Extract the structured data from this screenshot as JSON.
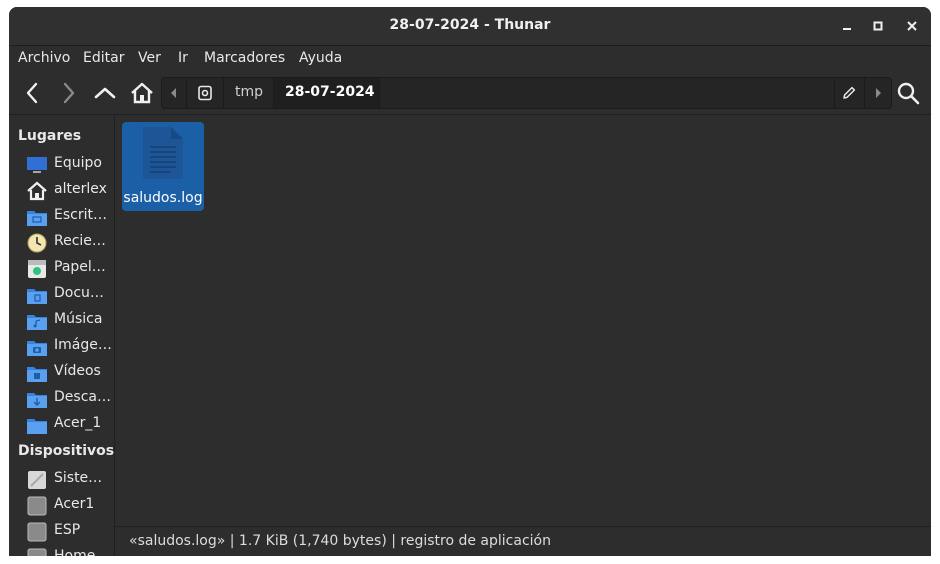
{
  "window": {
    "title": "28-07-2024 - Thunar"
  },
  "menubar": {
    "items": [
      "Archivo",
      "Editar",
      "Ver",
      "Ir",
      "Marcadores",
      "Ayuda"
    ]
  },
  "pathbar": {
    "segments": [
      "tmp",
      "28-07-2024"
    ]
  },
  "sidebar": {
    "places_header": "Lugares",
    "places": [
      {
        "label": "Equipo",
        "icon": "computer-icon"
      },
      {
        "label": "alterlex",
        "icon": "home-icon"
      },
      {
        "label": "Escrit…",
        "icon": "desktop-folder-icon"
      },
      {
        "label": "Recie…",
        "icon": "recent-clock-icon"
      },
      {
        "label": "Papel…",
        "icon": "trash-icon"
      },
      {
        "label": "Docu…",
        "icon": "documents-folder-icon"
      },
      {
        "label": "Música",
        "icon": "music-folder-icon"
      },
      {
        "label": "Imáge…",
        "icon": "pictures-folder-icon"
      },
      {
        "label": "Vídeos",
        "icon": "videos-folder-icon"
      },
      {
        "label": "Desca…",
        "icon": "downloads-folder-icon"
      },
      {
        "label": "Acer_1",
        "icon": "folder-icon"
      }
    ],
    "devices_header": "Dispositivos",
    "devices": [
      {
        "label": "Siste…",
        "icon": "system-drive-icon"
      },
      {
        "label": "Acer1",
        "icon": "drive-icon"
      },
      {
        "label": "ESP",
        "icon": "drive-icon"
      },
      {
        "label": "Home",
        "icon": "drive-icon"
      }
    ]
  },
  "files": [
    {
      "name": "saludos.log",
      "selected": true,
      "icon": "text-file-icon"
    }
  ],
  "statusbar": {
    "text": "«saludos.log»  |  1.7 KiB (1,740 bytes)  |  registro de aplicación"
  },
  "colors": {
    "accent": "#1b5fa7",
    "folder": "#3584e4",
    "background": "#2d2d2d"
  }
}
